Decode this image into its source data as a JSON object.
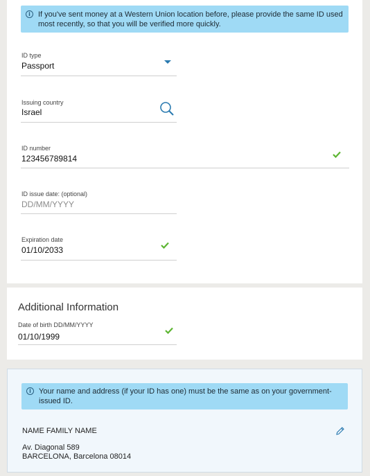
{
  "notice_id": {
    "icon": "info-icon",
    "text": "If you've sent money at a Western Union location before, please provide the same ID used most recently, so that you will be verified more quickly."
  },
  "id_form": {
    "id_type": {
      "label": "ID type",
      "value": "Passport"
    },
    "issuing_country": {
      "label": "Issuing country",
      "value": "Israel"
    },
    "id_number": {
      "label": "ID number",
      "value": "123456789814"
    },
    "issue_date": {
      "label": "ID issue date: (optional)",
      "placeholder": "DD/MM/YYYY"
    },
    "expiration_date": {
      "label": "Expiration date",
      "value": "01/10/2033"
    }
  },
  "additional_info": {
    "title": "Additional Information",
    "dob": {
      "label": "Date of birth DD/MM/YYYY",
      "value": "01/10/1999"
    }
  },
  "notice_name": {
    "icon": "info-icon",
    "text": "Your name and address (if your ID has one) must be the same as on your government-issued ID."
  },
  "identity": {
    "name": "NAME FAMILY NAME",
    "address_line1": "Av. Diagonal 589",
    "address_line2": "BARCELONA, Barcelona 08014",
    "edit_icon": "pencil-icon"
  },
  "colors": {
    "notice_bg": "#9fdaf5",
    "check_green": "#5cb531",
    "accent_blue": "#2a7ab0",
    "page_bg": "#ecebe8",
    "identity_bg": "#f1f7fc"
  }
}
